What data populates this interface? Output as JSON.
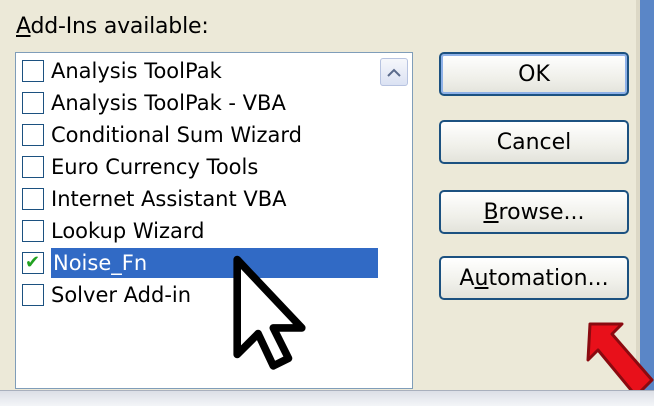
{
  "heading": {
    "first_letter": "A",
    "rest": "dd-Ins available:"
  },
  "addins": [
    {
      "label": "Analysis ToolPak",
      "checked": false
    },
    {
      "label": "Analysis ToolPak - VBA",
      "checked": false
    },
    {
      "label": "Conditional Sum Wizard",
      "checked": false
    },
    {
      "label": "Euro Currency Tools",
      "checked": false
    },
    {
      "label": "Internet Assistant VBA",
      "checked": false
    },
    {
      "label": "Lookup Wizard",
      "checked": false
    },
    {
      "label": "Noise_Fn",
      "checked": true
    },
    {
      "label": "Solver Add-in",
      "checked": false
    }
  ],
  "buttons": {
    "ok": "OK",
    "cancel": "Cancel",
    "browse_u": "B",
    "browse_rest": "rowse...",
    "automation_pre": "A",
    "automation_u": "u",
    "automation_rest": "tomation..."
  },
  "colors": {
    "selection": "#316ac5",
    "check": "#21a121",
    "annotation_arrow": "#e8101a"
  },
  "icons": [
    "checkbox-checked-icon",
    "scroll-up-arrow-icon",
    "mouse-pointer-icon",
    "red-annotation-arrow-icon"
  ]
}
